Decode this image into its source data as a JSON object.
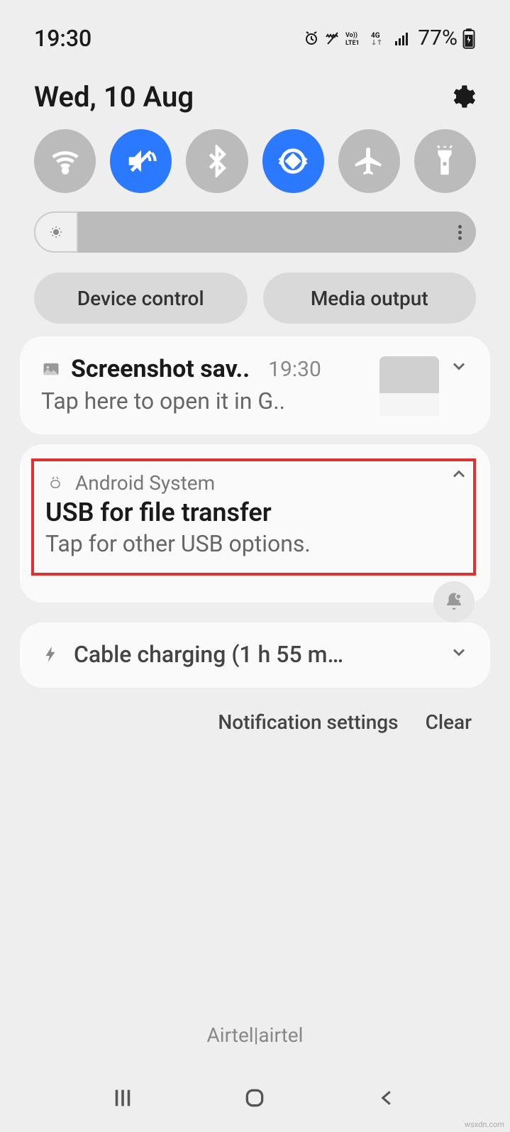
{
  "status": {
    "time": "19:30",
    "battery": "77%"
  },
  "header": {
    "date": "Wed, 10 Aug"
  },
  "controls": {
    "device_control": "Device control",
    "media_output": "Media output"
  },
  "notifications": {
    "screenshot": {
      "title": "Screenshot sav..",
      "time": "19:30",
      "body": "Tap here to open it in G.."
    },
    "android_system": {
      "app": "Android System",
      "title": "USB for file transfer",
      "body": "Tap for other USB options."
    },
    "charging": {
      "title": "Cable charging (1 h 55 m…"
    }
  },
  "footer": {
    "settings": "Notification settings",
    "clear": "Clear"
  },
  "carrier": "Airtel|airtel",
  "watermark": "wsxdn.com"
}
